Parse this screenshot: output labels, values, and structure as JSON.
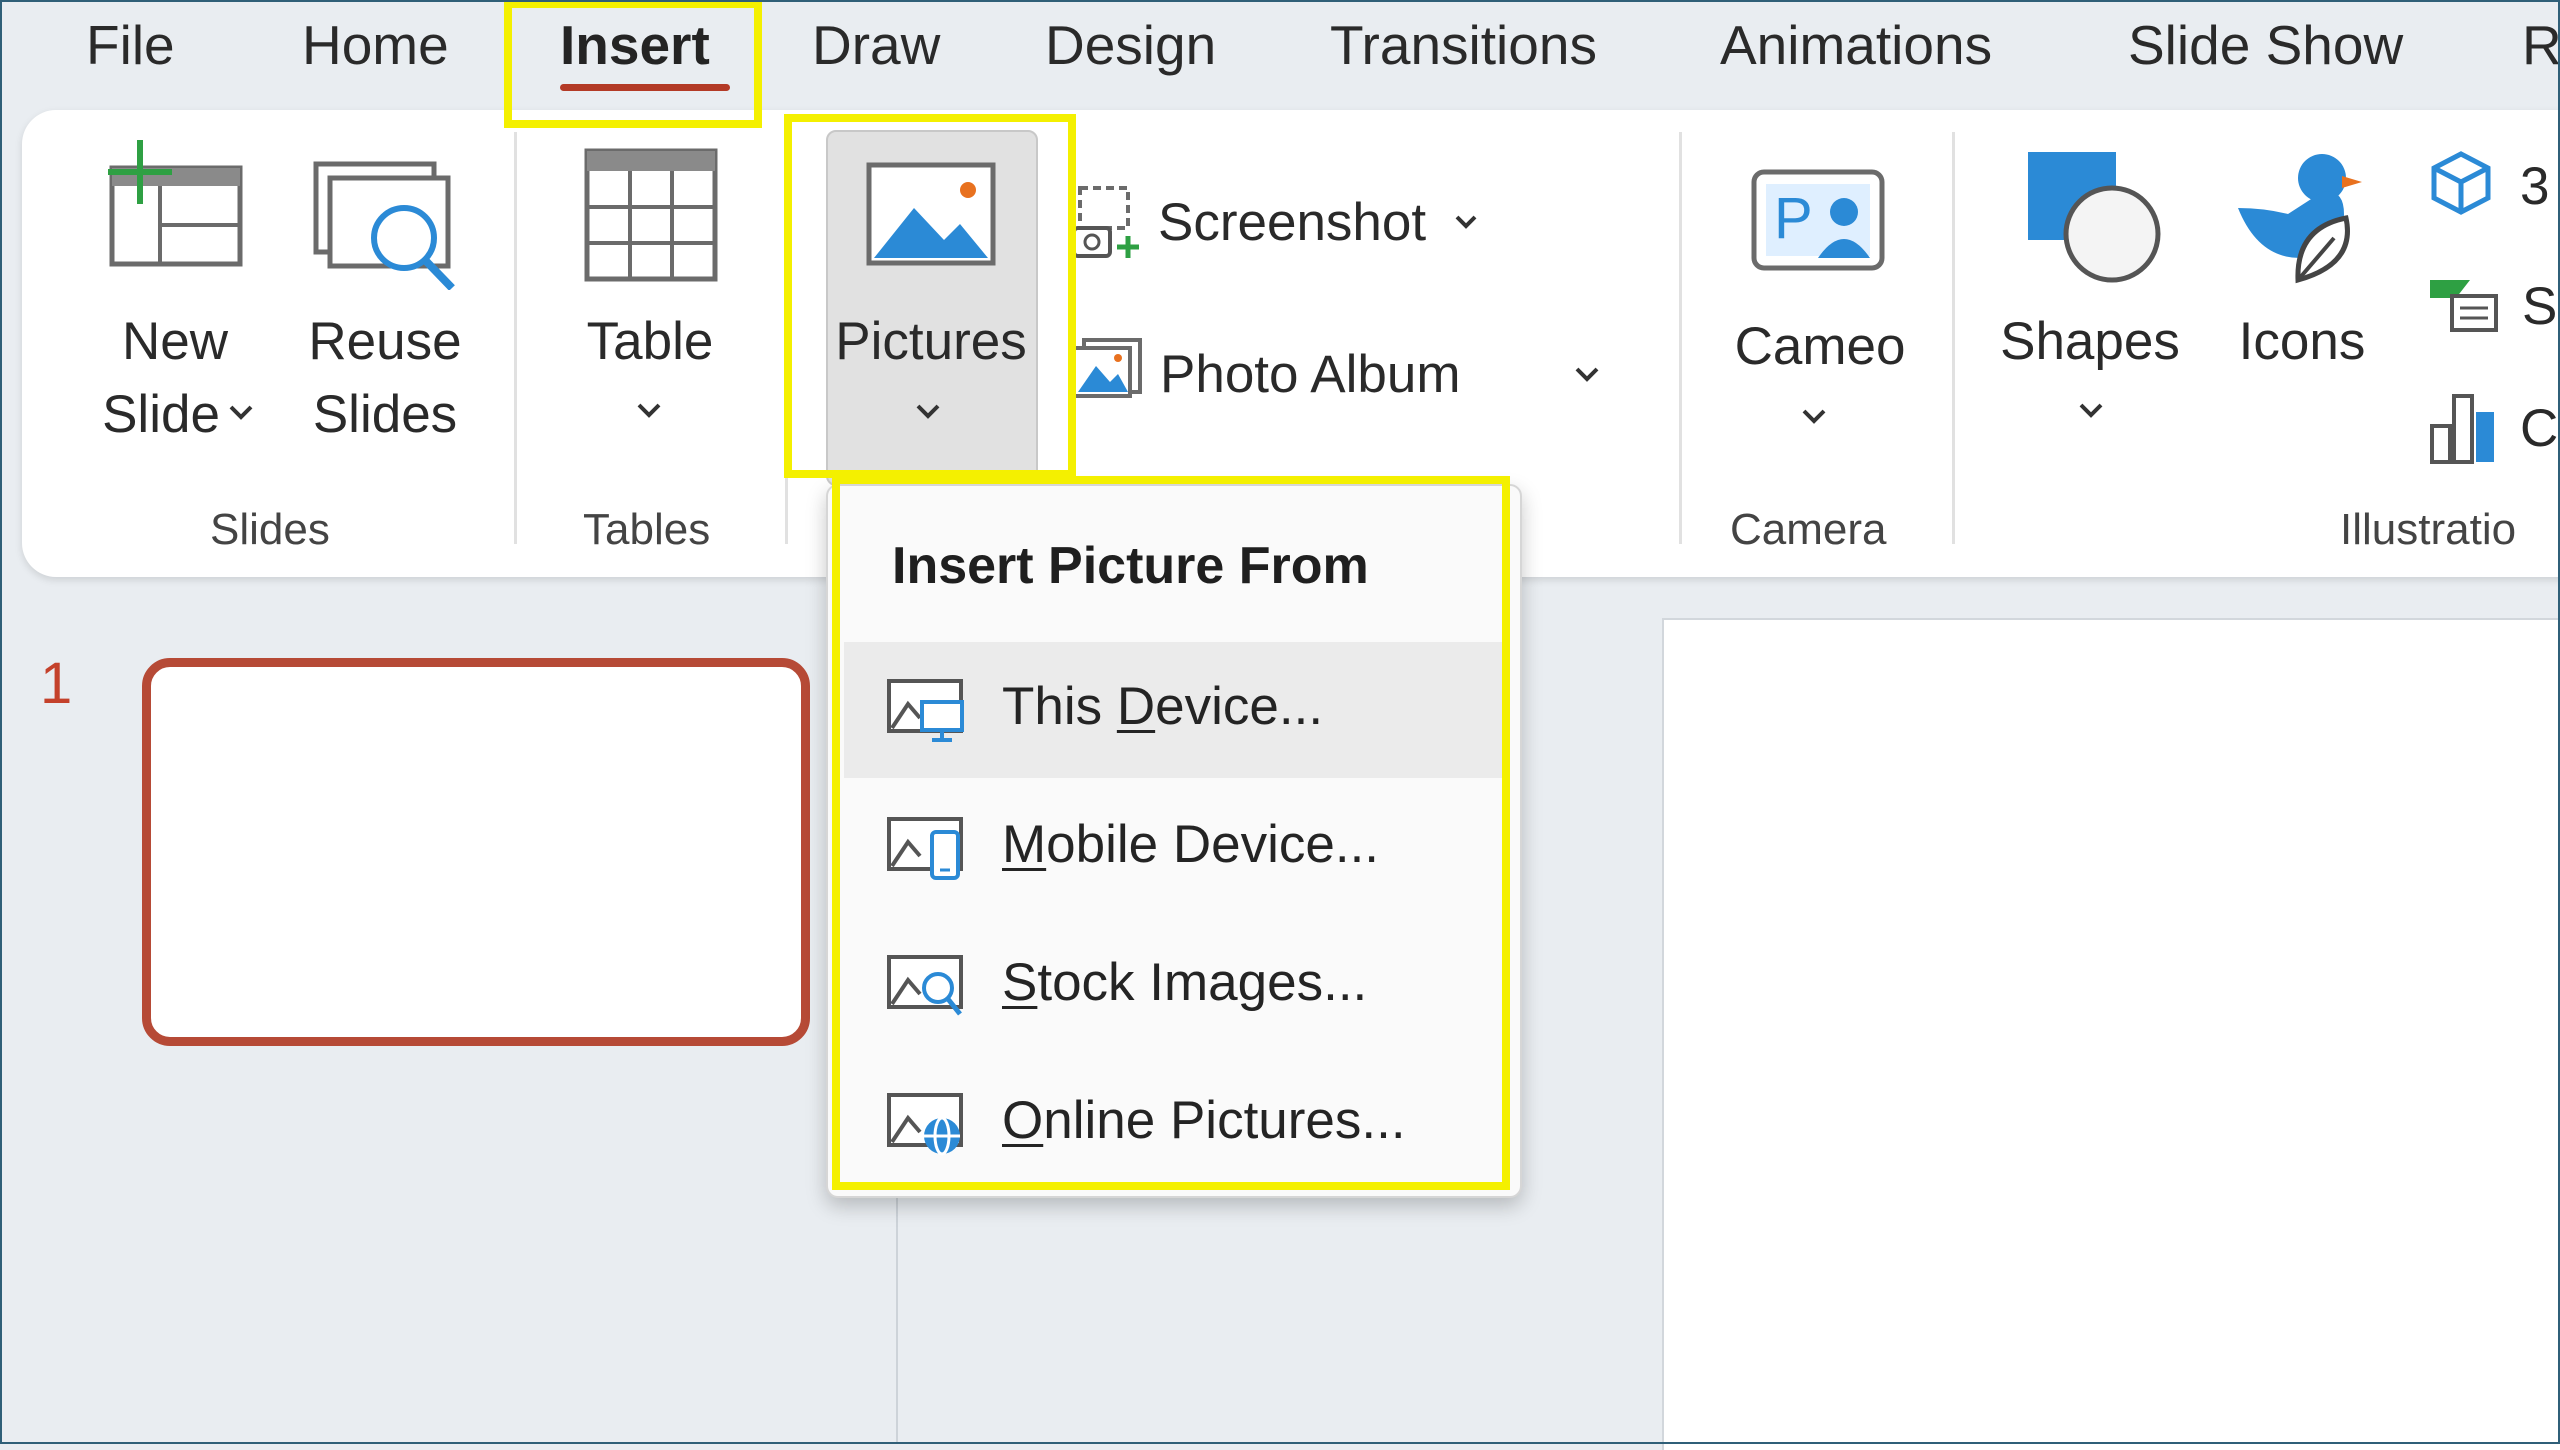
{
  "menu_tabs": [
    {
      "label": "File"
    },
    {
      "label": "Home"
    },
    {
      "label": "Insert",
      "active": true
    },
    {
      "label": "Draw"
    },
    {
      "label": "Design"
    },
    {
      "label": "Transitions"
    },
    {
      "label": "Animations"
    },
    {
      "label": "Slide Show"
    },
    {
      "label": "R"
    }
  ],
  "ribbon": {
    "slides_group": {
      "label": "Slides",
      "new_slide": {
        "line1": "New",
        "line2": "Slide"
      },
      "reuse_slides": {
        "line1": "Reuse",
        "line2": "Slides"
      }
    },
    "tables_group": {
      "label": "Tables",
      "table": "Table"
    },
    "images_group": {
      "pictures": "Pictures",
      "screenshot": "Screenshot",
      "photo_album": "Photo Album"
    },
    "camera_group": {
      "label": "Camera",
      "cameo": "Cameo"
    },
    "illustrations_group": {
      "label": "Illustratio",
      "shapes": "Shapes",
      "icons": "Icons",
      "partial_3d": "3",
      "partial_smartart": "S",
      "partial_chart": "C"
    }
  },
  "slides_pane": {
    "slide_number": "1"
  },
  "picture_menu": {
    "title": "Insert Picture From",
    "items": [
      {
        "pre": "This ",
        "key": "D",
        "post": "evice..."
      },
      {
        "pre": "",
        "key": "M",
        "post": "obile Device..."
      },
      {
        "pre": "",
        "key": "S",
        "post": "tock Images..."
      },
      {
        "pre": "",
        "key": "O",
        "post": "nline Pictures..."
      }
    ]
  },
  "colors": {
    "accent": "#b33a26",
    "highlight": "#f4f000",
    "icon_blue": "#2b8ad6",
    "icon_green": "#2ea043"
  }
}
